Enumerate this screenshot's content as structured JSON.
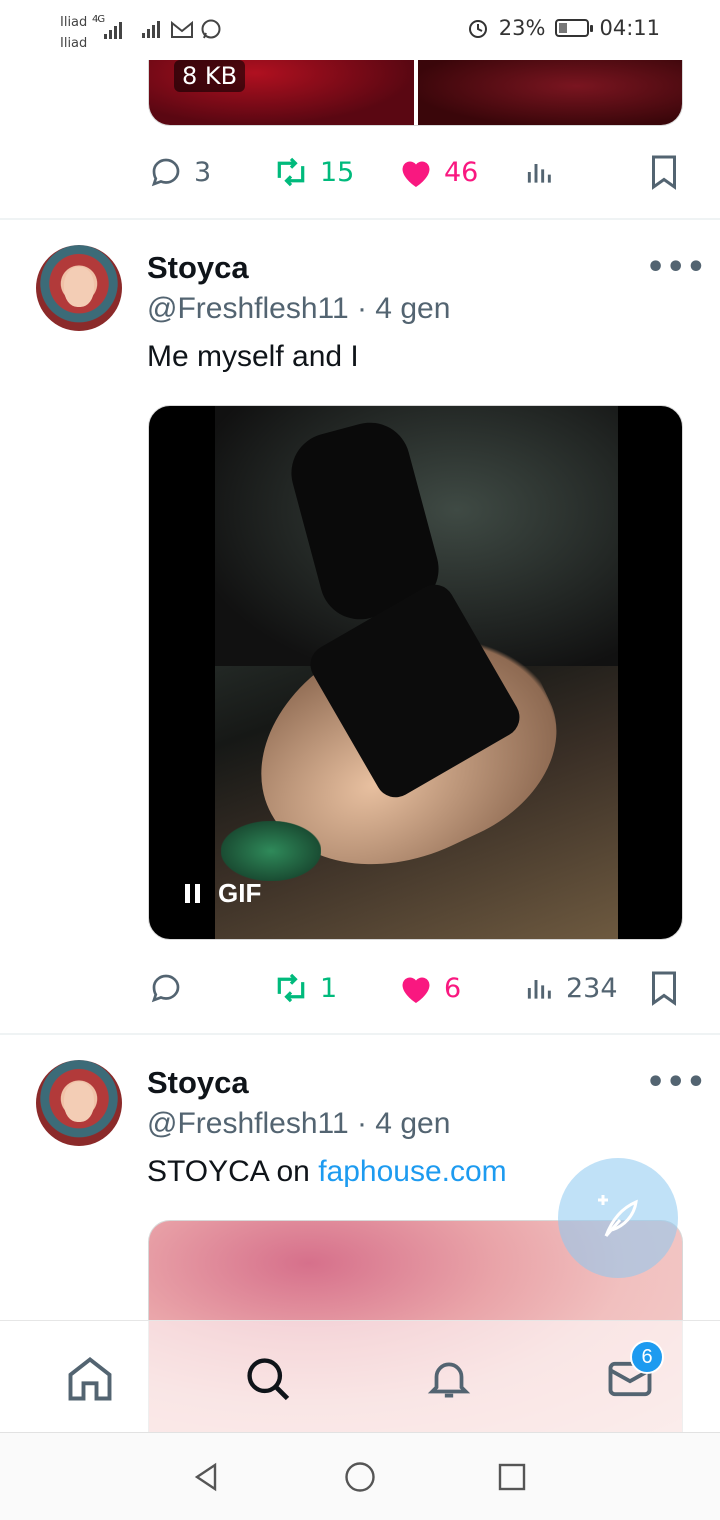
{
  "status_bar": {
    "carrier_1": "Iliad",
    "carrier_2": "Iliad",
    "network_type": "4G",
    "battery": "23%",
    "time": "04:11"
  },
  "feed": {
    "top_tweet": {
      "media_badge": "8 KB",
      "replies": "3",
      "retweets": "15",
      "likes": "46"
    },
    "tweets": [
      {
        "name": "Stoyca",
        "handle": "@Freshflesh11 · 4 gen",
        "text": "Me myself and I",
        "media_label": "GIF",
        "replies": "",
        "retweets": "1",
        "likes": "6",
        "views": "234"
      },
      {
        "name": "Stoyca",
        "handle": "@Freshflesh11 · 4 gen",
        "text_prefix": "STOYCA on ",
        "text_link": "faphouse.com"
      }
    ]
  },
  "bottom_nav": {
    "items": [
      "home-icon",
      "search-icon",
      "notifications-icon",
      "messages-icon"
    ],
    "messages_badge": "6"
  },
  "colors": {
    "retweet": "#00ba7c",
    "like": "#f91880",
    "muted": "#536471",
    "link": "#1d9bf0"
  }
}
